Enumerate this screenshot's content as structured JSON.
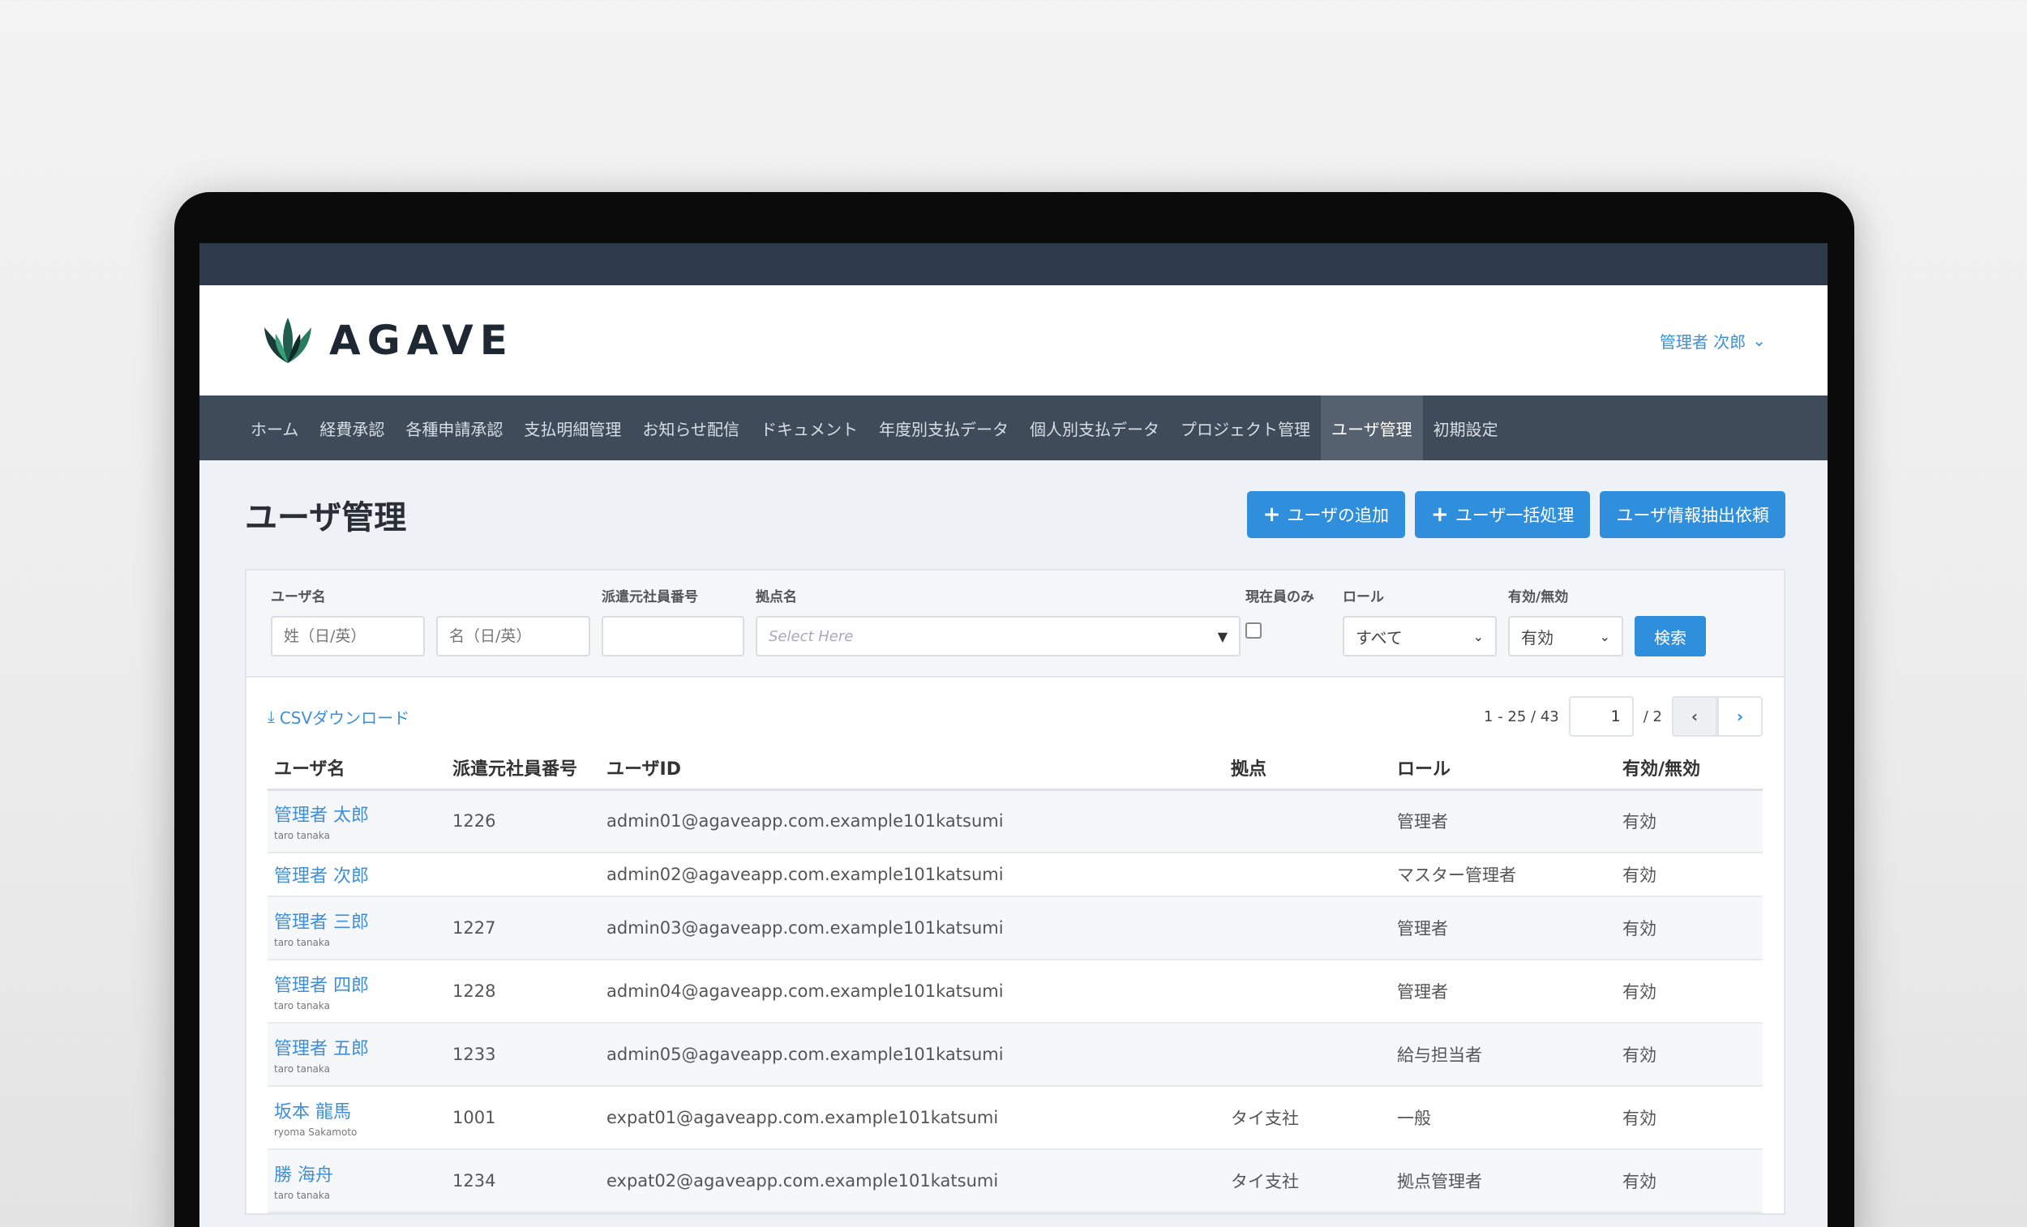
{
  "header": {
    "logo_text": "AGAVE",
    "user_menu": "管理者 次郎"
  },
  "nav": [
    {
      "label": "ホーム",
      "active": false
    },
    {
      "label": "経費承認",
      "active": false
    },
    {
      "label": "各種申請承認",
      "active": false
    },
    {
      "label": "支払明細管理",
      "active": false
    },
    {
      "label": "お知らせ配信",
      "active": false
    },
    {
      "label": "ドキュメント",
      "active": false
    },
    {
      "label": "年度別支払データ",
      "active": false
    },
    {
      "label": "個人別支払データ",
      "active": false
    },
    {
      "label": "プロジェクト管理",
      "active": false
    },
    {
      "label": "ユーザ管理",
      "active": true
    },
    {
      "label": "初期設定",
      "active": false
    }
  ],
  "page": {
    "title": "ユーザ管理",
    "buttons": {
      "add_user": "ユーザの追加",
      "bulk": "ユーザ一括処理",
      "export": "ユーザ情報抽出依頼"
    }
  },
  "filters": {
    "user_label": "ユーザ名",
    "last_placeholder": "姓（日/英）",
    "first_placeholder": "名（日/英）",
    "emp_label": "派遣元社員番号",
    "base_label": "拠点名",
    "base_placeholder": "Select Here",
    "present_label": "現在員のみ",
    "role_label": "ロール",
    "role_value": "すべて",
    "status_label": "有効/無効",
    "status_value": "有効",
    "search_button": "検索"
  },
  "tools": {
    "csv": "CSVダウンロード",
    "range": "1 - 25 / 43",
    "page": "1",
    "total": "/ 2"
  },
  "table": {
    "headers": [
      "ユーザ名",
      "派遣元社員番号",
      "ユーザID",
      "拠点",
      "ロール",
      "有効/無効"
    ],
    "rows": [
      {
        "name": "管理者 太郎",
        "sub": "taro tanaka",
        "emp": "1226",
        "id": "admin01@agaveapp.com.example101katsumi",
        "base": "",
        "role": "管理者",
        "status": "有効"
      },
      {
        "name": "管理者 次郎",
        "sub": "",
        "emp": "",
        "id": "admin02@agaveapp.com.example101katsumi",
        "base": "",
        "role": "マスター管理者",
        "status": "有効"
      },
      {
        "name": "管理者 三郎",
        "sub": "taro tanaka",
        "emp": "1227",
        "id": "admin03@agaveapp.com.example101katsumi",
        "base": "",
        "role": "管理者",
        "status": "有効"
      },
      {
        "name": "管理者 四郎",
        "sub": "taro tanaka",
        "emp": "1228",
        "id": "admin04@agaveapp.com.example101katsumi",
        "base": "",
        "role": "管理者",
        "status": "有効"
      },
      {
        "name": "管理者 五郎",
        "sub": "taro tanaka",
        "emp": "1233",
        "id": "admin05@agaveapp.com.example101katsumi",
        "base": "",
        "role": "給与担当者",
        "status": "有効"
      },
      {
        "name": "坂本 龍馬",
        "sub": "ryoma Sakamoto",
        "emp": "1001",
        "id": "expat01@agaveapp.com.example101katsumi",
        "base": "タイ支社",
        "role": "一般",
        "status": "有効"
      },
      {
        "name": "勝 海舟",
        "sub": "taro tanaka",
        "emp": "1234",
        "id": "expat02@agaveapp.com.example101katsumi",
        "base": "タイ支社",
        "role": "拠点管理者",
        "status": "有効"
      }
    ]
  },
  "colors": {
    "accent": "#2f8fdd",
    "nav_bg": "#3f4b58",
    "topbar": "#2c3a4a"
  }
}
